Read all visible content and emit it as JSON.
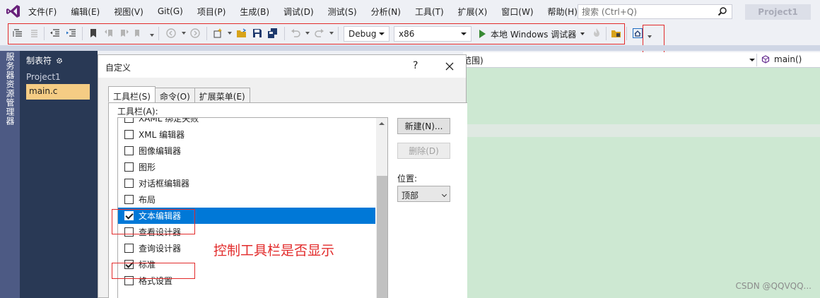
{
  "app": {
    "logo_icon": "visual-studio-logo-icon",
    "menu": [
      "文件(F)",
      "编辑(E)",
      "视图(V)",
      "Git(G)",
      "项目(P)",
      "生成(B)",
      "调试(D)",
      "测试(S)",
      "分析(N)",
      "工具(T)",
      "扩展(X)",
      "窗口(W)",
      "帮助(H)"
    ],
    "search_placeholder": "搜索 (Ctrl+Q)",
    "project_name": "Project1"
  },
  "toolbar": {
    "configuration": "Debug",
    "platform": "x86",
    "run_label": "本地 Windows 调试器",
    "accent_color": "#388a34"
  },
  "side_rail": {
    "label": "服务器资源管理器"
  },
  "tab_panel": {
    "title": "制表符",
    "project": "Project1",
    "file": "main.c"
  },
  "nav": {
    "scope": "范围)",
    "function": "main()"
  },
  "dialog": {
    "title": "自定义",
    "help": "?",
    "tabs": [
      "工具栏(S)",
      "命令(O)",
      "扩展菜单(E)"
    ],
    "active_tab": "工具栏(S)",
    "list_label": "工具栏(A):",
    "toolbars": [
      {
        "label": "XAML 绑定失败",
        "checked": false,
        "selected": false
      },
      {
        "label": "XML 编辑器",
        "checked": false,
        "selected": false
      },
      {
        "label": "图像编辑器",
        "checked": false,
        "selected": false
      },
      {
        "label": "图形",
        "checked": false,
        "selected": false
      },
      {
        "label": "对话框编辑器",
        "checked": false,
        "selected": false
      },
      {
        "label": "布局",
        "checked": false,
        "selected": false
      },
      {
        "label": "文本编辑器",
        "checked": true,
        "selected": true
      },
      {
        "label": "查看设计器",
        "checked": false,
        "selected": false
      },
      {
        "label": "查询设计器",
        "checked": false,
        "selected": false
      },
      {
        "label": "标准",
        "checked": true,
        "selected": false
      },
      {
        "label": "格式设置",
        "checked": false,
        "selected": false
      }
    ],
    "new_button": "新建(N)...",
    "delete_button": "删除(D)",
    "position_label": "位置:",
    "position_value": "顶部"
  },
  "annotation": "控制工具栏是否显示",
  "watermark": "CSDN @QQVQQ...",
  "colors": {
    "highlight": "#e22b2b",
    "selection": "#0078d7",
    "editor_bg": "#cde8d2",
    "tab_file_bg": "#f5cc84"
  }
}
